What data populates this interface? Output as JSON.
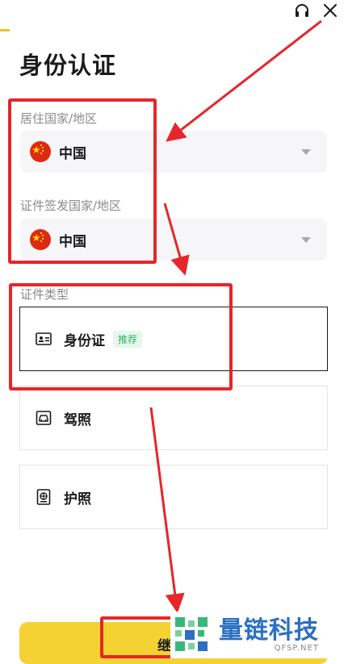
{
  "header": {
    "support_icon": "headset-icon",
    "close_icon": "close-icon",
    "title": "身份认证"
  },
  "residence": {
    "label": "居住国家/地区",
    "value": "中国",
    "flag": "china-flag-icon"
  },
  "issuing": {
    "label": "证件签发国家/地区",
    "value": "中国",
    "flag": "china-flag-icon"
  },
  "doc_type": {
    "label": "证件类型",
    "options": [
      {
        "label": "身份证",
        "badge": "推荐",
        "icon": "id-card-icon",
        "selected": true
      },
      {
        "label": "驾照",
        "icon": "driver-license-icon",
        "selected": false
      },
      {
        "label": "护照",
        "icon": "passport-icon",
        "selected": false
      }
    ]
  },
  "footer": {
    "continue_label": "继"
  },
  "watermark": {
    "name": "量链科技",
    "domain": "QFSP.NET"
  },
  "colors": {
    "accent": "#f5d233",
    "annotation_red": "#e6262a",
    "recommend_green": "#2fb36b"
  }
}
